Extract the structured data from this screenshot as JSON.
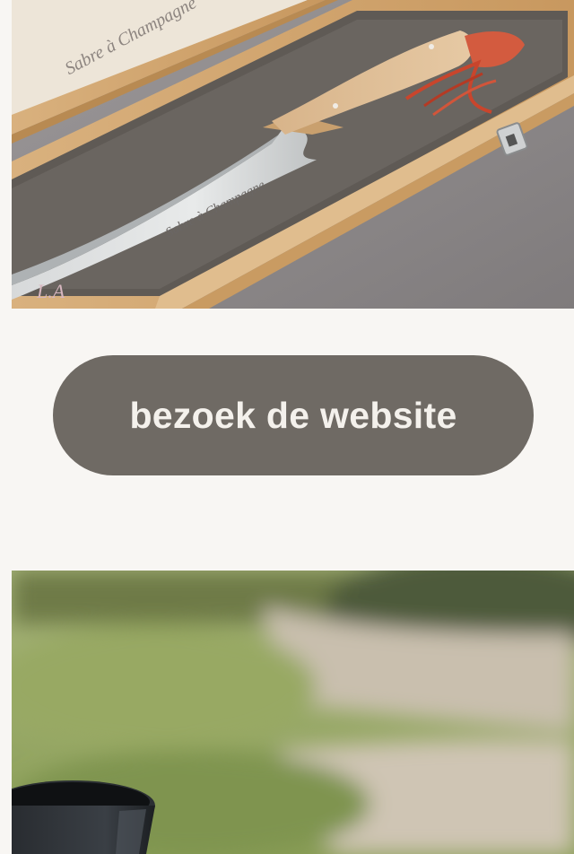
{
  "photos": {
    "top": {
      "subject": "sabre-in-wooden-box",
      "engraved_text": "Sabre à Champagne",
      "certificate_text": "Sabre à Champagne",
      "watermark_text": "L.A"
    },
    "bottom": {
      "subject": "garden-path-with-bucket"
    }
  },
  "cta": {
    "label": "bezoek de website"
  },
  "colors": {
    "background": "#f8f6f3",
    "button": "#6f6a64",
    "button_text": "#f4f1ec"
  }
}
